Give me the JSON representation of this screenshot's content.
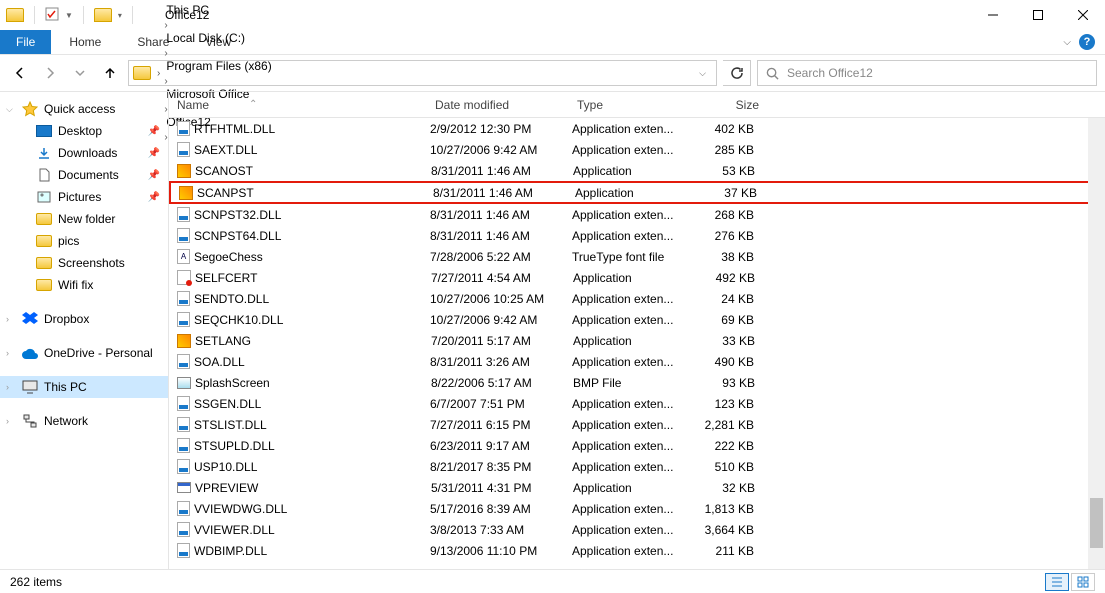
{
  "window": {
    "title": "Office12"
  },
  "menu": {
    "file": "File",
    "home": "Home",
    "share": "Share",
    "view": "View"
  },
  "breadcrumb": [
    "This PC",
    "Local Disk (C:)",
    "Program Files (x86)",
    "Microsoft Office",
    "Office12"
  ],
  "search": {
    "placeholder": "Search Office12"
  },
  "columns": {
    "name": "Name",
    "date": "Date modified",
    "type": "Type",
    "size": "Size"
  },
  "sidebar": {
    "quick_access": "Quick access",
    "desktop": "Desktop",
    "downloads": "Downloads",
    "documents": "Documents",
    "pictures": "Pictures",
    "new_folder": "New folder",
    "pics": "pics",
    "screenshots": "Screenshots",
    "wifi_fix": "Wifi fix",
    "dropbox": "Dropbox",
    "onedrive": "OneDrive - Personal",
    "this_pc": "This PC",
    "network": "Network"
  },
  "files": [
    {
      "name": "RTFHTML.DLL",
      "date": "2/9/2012 12:30 PM",
      "type": "Application exten...",
      "size": "402 KB",
      "icon": "dll",
      "hl": false
    },
    {
      "name": "SAEXT.DLL",
      "date": "10/27/2006 9:42 AM",
      "type": "Application exten...",
      "size": "285 KB",
      "icon": "dll",
      "hl": false
    },
    {
      "name": "SCANOST",
      "date": "8/31/2011 1:46 AM",
      "type": "Application",
      "size": "53 KB",
      "icon": "exe",
      "hl": false
    },
    {
      "name": "SCANPST",
      "date": "8/31/2011 1:46 AM",
      "type": "Application",
      "size": "37 KB",
      "icon": "exe",
      "hl": true
    },
    {
      "name": "SCNPST32.DLL",
      "date": "8/31/2011 1:46 AM",
      "type": "Application exten...",
      "size": "268 KB",
      "icon": "dll",
      "hl": false
    },
    {
      "name": "SCNPST64.DLL",
      "date": "8/31/2011 1:46 AM",
      "type": "Application exten...",
      "size": "276 KB",
      "icon": "dll",
      "hl": false
    },
    {
      "name": "SegoeChess",
      "date": "7/28/2006 5:22 AM",
      "type": "TrueType font file",
      "size": "38 KB",
      "icon": "ttf",
      "hl": false
    },
    {
      "name": "SELFCERT",
      "date": "7/27/2011 4:54 AM",
      "type": "Application",
      "size": "492 KB",
      "icon": "cert",
      "hl": false
    },
    {
      "name": "SENDTO.DLL",
      "date": "10/27/2006 10:25 AM",
      "type": "Application exten...",
      "size": "24 KB",
      "icon": "dll",
      "hl": false
    },
    {
      "name": "SEQCHK10.DLL",
      "date": "10/27/2006 9:42 AM",
      "type": "Application exten...",
      "size": "69 KB",
      "icon": "dll",
      "hl": false
    },
    {
      "name": "SETLANG",
      "date": "7/20/2011 5:17 AM",
      "type": "Application",
      "size": "33 KB",
      "icon": "exe",
      "hl": false
    },
    {
      "name": "SOA.DLL",
      "date": "8/31/2011 3:26 AM",
      "type": "Application exten...",
      "size": "490 KB",
      "icon": "dll",
      "hl": false
    },
    {
      "name": "SplashScreen",
      "date": "8/22/2006 5:17 AM",
      "type": "BMP File",
      "size": "93 KB",
      "icon": "bmp",
      "hl": false
    },
    {
      "name": "SSGEN.DLL",
      "date": "6/7/2007 7:51 PM",
      "type": "Application exten...",
      "size": "123 KB",
      "icon": "dll",
      "hl": false
    },
    {
      "name": "STSLIST.DLL",
      "date": "7/27/2011 6:15 PM",
      "type": "Application exten...",
      "size": "2,281 KB",
      "icon": "dll",
      "hl": false
    },
    {
      "name": "STSUPLD.DLL",
      "date": "6/23/2011 9:17 AM",
      "type": "Application exten...",
      "size": "222 KB",
      "icon": "dll",
      "hl": false
    },
    {
      "name": "USP10.DLL",
      "date": "8/21/2017 8:35 PM",
      "type": "Application exten...",
      "size": "510 KB",
      "icon": "dll",
      "hl": false
    },
    {
      "name": "VPREVIEW",
      "date": "5/31/2011 4:31 PM",
      "type": "Application",
      "size": "32 KB",
      "icon": "window",
      "hl": false
    },
    {
      "name": "VVIEWDWG.DLL",
      "date": "5/17/2016 8:39 AM",
      "type": "Application exten...",
      "size": "1,813 KB",
      "icon": "dll",
      "hl": false
    },
    {
      "name": "VVIEWER.DLL",
      "date": "3/8/2013 7:33 AM",
      "type": "Application exten...",
      "size": "3,664 KB",
      "icon": "dll",
      "hl": false
    },
    {
      "name": "WDBIMP.DLL",
      "date": "9/13/2006 11:10 PM",
      "type": "Application exten...",
      "size": "211 KB",
      "icon": "dll",
      "hl": false
    }
  ],
  "status": {
    "count": "262 items"
  }
}
